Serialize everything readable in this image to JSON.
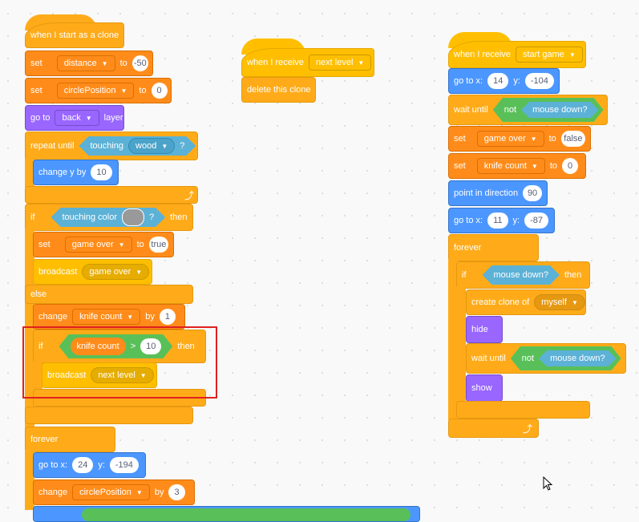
{
  "colors": {
    "events": "#ffbf00",
    "control": "#ffab19",
    "variables": "#ff8c1a",
    "motion": "#4c97ff",
    "looks": "#9966ff",
    "sensing": "#5cb1d6",
    "operators": "#59c059",
    "highlight": "#e02020"
  },
  "script1": {
    "hat": "when I start as a clone",
    "set1": {
      "label": "set",
      "var": "distance",
      "to": "to",
      "value": "-50"
    },
    "set2": {
      "label": "set",
      "var": "circlePosition",
      "to": "to",
      "value": "0"
    },
    "goto_layer": {
      "label": "go to",
      "option": "back",
      "suffix": "layer"
    },
    "repeat_until": {
      "label": "repeat until",
      "cond_label": "touching",
      "cond_option": "wood",
      "q": "?"
    },
    "change_y": {
      "label": "change y by",
      "value": "10"
    },
    "if_color": {
      "label": "if",
      "cond_label": "touching color",
      "q": "?",
      "then": "then"
    },
    "set_gameover": {
      "label": "set",
      "var": "game over",
      "to": "to",
      "value": "true"
    },
    "broadcast_gameover": {
      "label": "broadcast",
      "option": "game over"
    },
    "else": "else",
    "change_knife": {
      "label": "change",
      "var": "knife count",
      "by": "by",
      "value": "1"
    },
    "if_knife": {
      "label": "if",
      "reporter": "knife count",
      "op": ">",
      "value": "10",
      "then": "then"
    },
    "broadcast_next": {
      "label": "broadcast",
      "option": "next level"
    },
    "forever": "forever",
    "goto_xy": {
      "label": "go to x:",
      "x": "24",
      "ylabel": "y:",
      "y": "-194"
    },
    "change_circle": {
      "label": "change",
      "var": "circlePosition",
      "by": "by",
      "value": "3"
    }
  },
  "script2": {
    "hat": "when I receive",
    "option": "next level",
    "delete": "delete this clone"
  },
  "script3": {
    "hat": "when I receive",
    "option": "start game",
    "goto1": {
      "label": "go to x:",
      "x": "14",
      "ylabel": "y:",
      "y": "-104"
    },
    "wait1": {
      "label": "wait until",
      "not": "not",
      "cond": "mouse down?"
    },
    "set_gameover": {
      "label": "set",
      "var": "game over",
      "to": "to",
      "value": "false"
    },
    "set_knife": {
      "label": "set",
      "var": "knife count",
      "to": "to",
      "value": "0"
    },
    "point": {
      "label": "point in direction",
      "value": "90"
    },
    "goto2": {
      "label": "go to x:",
      "x": "11",
      "ylabel": "y:",
      "y": "-87"
    },
    "forever": "forever",
    "if": {
      "label": "if",
      "cond": "mouse down?",
      "then": "then"
    },
    "clone": {
      "label": "create clone of",
      "option": "myself"
    },
    "hide": "hide",
    "wait2": {
      "label": "wait until",
      "not": "not",
      "cond": "mouse down?"
    },
    "show": "show"
  }
}
